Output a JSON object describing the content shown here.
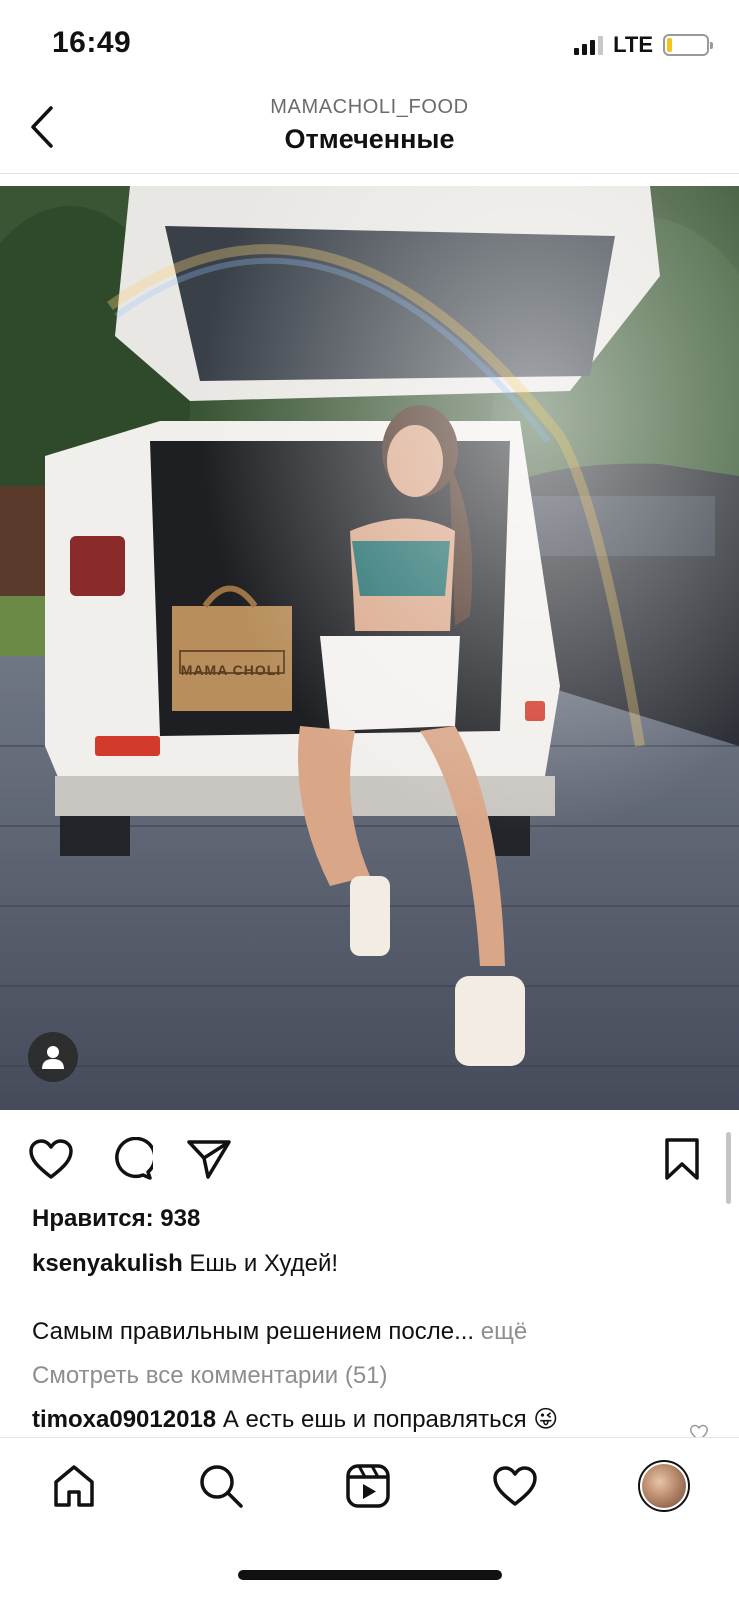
{
  "status_bar": {
    "time": "16:49",
    "network": "LTE"
  },
  "header": {
    "subtitle": "MAMACHOLI_FOOD",
    "title": "Отмеченные"
  },
  "post": {
    "bag_text": "MAMA CHOLI",
    "likes": "Нравится: 938",
    "caption_user": "ksenyakulish",
    "caption_text": "Ешь и Худей!",
    "caption_more_text": "Самым правильным решением после...",
    "caption_more_link": "ещё",
    "view_comments": "Смотреть все комментарии (51)",
    "comment_user": "timoxa09012018",
    "comment_text": "А есть ешь и поправляться 😜"
  },
  "colors": {
    "accent": "#111111",
    "muted": "#8e8e8e",
    "battery": "#f3c51b"
  },
  "icons": {
    "back": "chevron-left-icon",
    "like": "heart-icon",
    "comment": "comment-bubble-icon",
    "share": "paper-plane-icon",
    "save": "bookmark-icon",
    "home": "home-icon",
    "search": "search-icon",
    "reels": "reels-icon",
    "activity": "heart-icon",
    "profile": "profile-avatar"
  }
}
